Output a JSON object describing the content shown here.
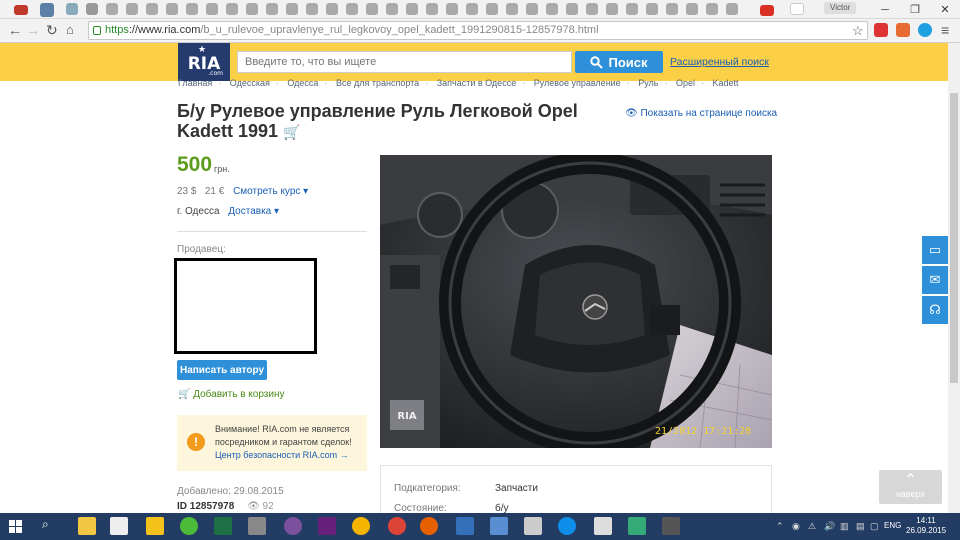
{
  "browser": {
    "user_name": "Victor",
    "url_https": "https",
    "url_host": "://www.ria.com",
    "url_path": "/b_u_rulevoe_upravlenye_rul_legkovoy_opel_kadett_1991290815-12857978.html"
  },
  "header": {
    "logo_text": "RIA",
    "logo_sub": ".com",
    "search_placeholder": "Введите то, что вы ищете",
    "search_button": "Поиск",
    "advanced_search": "Расширенный поиск"
  },
  "breadcrumb": [
    "Главная",
    "Одесская",
    "Одесса",
    "Все для транспорта",
    "Запчасти в Одессе",
    "Рулевое управление",
    "Руль",
    "Opel",
    "Kadett"
  ],
  "listing": {
    "title": "Б/у Рулевое управление Руль Легковой Opel Kadett 1991",
    "show_on_search": "Показать на странице поиска",
    "price": "500",
    "price_unit": "грн.",
    "usd": "23 $",
    "eur": "21 €",
    "rate_link": "Смотреть курс",
    "city": "г. Одесса",
    "delivery_link": "Доставка",
    "seller_label": "Продавец:",
    "write_author": "Написать автору",
    "add_to_cart": "Добавить в корзину",
    "warning_text": "Внимание! RIA.com не является посредником и гарантом сделок!",
    "warning_link": "Центр безопасности RIA.com →",
    "added": "Добавлено: 29.08.2015",
    "id": "ID 12857978",
    "views": "92",
    "photo_watermark": "RIA",
    "photo_timestamp": "21/2012 17:21:28"
  },
  "specs": [
    {
      "label": "Подкатегория:",
      "value": "Запчасти"
    },
    {
      "label": "Состояние:",
      "value": "б/у"
    }
  ],
  "side": {
    "back_to_top": "наверх"
  },
  "taskbar": {
    "lang": "ENG",
    "time": "14:11",
    "date": "26.09.2015"
  },
  "colors": {
    "header_bg": "#fbd047",
    "accent": "#2d90d8",
    "price": "#5b9c1c",
    "logo_bg": "#253b6d"
  }
}
